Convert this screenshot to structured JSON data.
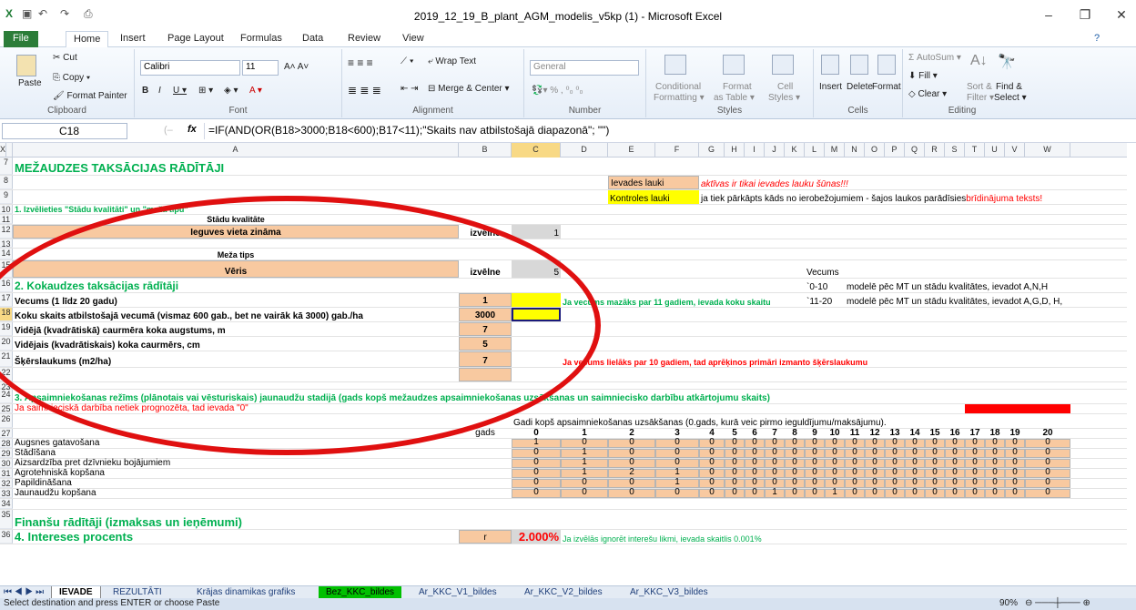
{
  "window": {
    "title": "2019_12_19_B_plant_AGM_modelis_v5kp (1)  -  Microsoft Excel",
    "min": "–",
    "max": "❐",
    "close": "✕"
  },
  "tabs": [
    "File",
    "Home",
    "Insert",
    "Page Layout",
    "Formulas",
    "Data",
    "Review",
    "View"
  ],
  "ribbon": {
    "clipboard": {
      "paste": "Paste",
      "cut": "Cut",
      "copy": "Copy ▾",
      "painter": "Format Painter",
      "label": "Clipboard"
    },
    "font": {
      "name": "Calibri",
      "size": "11",
      "label": "Font"
    },
    "alignment": {
      "wrap": "Wrap Text",
      "merge": "Merge & Center ▾",
      "label": "Alignment"
    },
    "number": {
      "format": "General",
      "label": "Number"
    },
    "styles": {
      "cond": "Conditional",
      "cond2": "Formatting ▾",
      "fmt": "Format",
      "fmt2": "as Table ▾",
      "cell": "Cell",
      "cell2": "Styles ▾",
      "label": "Styles"
    },
    "cells": {
      "insert": "Insert",
      "delete": "Delete",
      "format": "Format",
      "label": "Cells"
    },
    "editing": {
      "autosum": "Σ AutoSum ▾",
      "fill": "Fill ▾",
      "clear": "Clear ▾",
      "sort": "Sort &",
      "sort2": "Filter ▾",
      "find": "Find &",
      "find2": "Select ▾",
      "label": "Editing"
    }
  },
  "namebox": "C18",
  "fx": "fx",
  "formula": "=IF(AND(OR(B18>3000;B18<600);B17<11);\"Skaits nav atbilstošajā diapazonā\"; \"\")",
  "columns": [
    "A",
    "B",
    "C",
    "D",
    "E",
    "F",
    "G",
    "H",
    "I",
    "J",
    "K",
    "L",
    "M",
    "N",
    "O",
    "P",
    "Q",
    "R",
    "S",
    "T",
    "U",
    "V",
    "W",
    "X"
  ],
  "rows": {
    "r7": "MEŽAUDZES TAKSĀCIJAS RĀDĪTĀJI",
    "r8_e": "Ievades lauki",
    "r8_g": "aktīvas ir tikai ievades lauku šūnas!!!",
    "r9_e": "Kontroles lauki",
    "r9_g": "ja tiek pārkāpts kāds no ierobežojumiem - šajos laukos parādīsies ",
    "r9_g2": "brīdinājuma teksts!",
    "r10": "1. Izvēlieties \"Stādu kvalitāti\" un \"meža tipu\"",
    "r11": "Stādu kvalitāte",
    "r12": "Ieguves vieta zināma",
    "r12_b": "izvēlne",
    "r12_c": "1",
    "r14": "Meža tips",
    "r15": "Vēris",
    "r15_b": "izvēlne",
    "r15_c": "5",
    "r15_l": "Vecums",
    "r16": "2.  Kokaudzes taksācijas rādītāji",
    "r16_l": "`0-10",
    "r16_m": "modelē pēc MT un stādu kvalitātes, ievadot A,N,H",
    "r17": "Vecums (1 līdz 20 gadu)",
    "r17_b": "1",
    "r17_e": "Ja vecums mazāks par 11 gadiem, ievada koku skaitu",
    "r17_l": "`11-20",
    "r17_m": "modelē pēc MT un stādu kvalitātes, ievadot A,G,D, H,",
    "r18": "Koku skaits atbilstošajā vecumā (vismaz 600 gab., bet ne vairāk kā 3000) gab./ha",
    "r18_b": "3000",
    "r19": "Vidējā (kvadrātiskā) caurmēra koka augstums, m",
    "r19_b": "7",
    "r20": "Vidējais (kvadrātiskais) koka caurmērs, cm",
    "r20_b": "5",
    "r21": "Šķērslaukums (m2/ha)",
    "r21_b": "7",
    "r21_e": "Ja vecums lielāks par 10 gadiem, tad aprēķinos primāri izmanto šķērslaukumu",
    "r24": "3. Apsaimniekošanas režīms (plānotais vai vēsturiskais) jaunaudžu stadijā (gads kopš mežaudzes apsaimniekošanas uzsākšanas un saimniecisko darbību atkārtojumu skaits)",
    "r25": "Ja saimnieciskā darbība netiek prognozēta, tad ievada \"0\"",
    "r26": "Gadi kopš apsaimniekošanas uzsākšanas (0.gads, kurā veic pirmo ieguldījumu/maksājumu).",
    "r27_b": "gads",
    "years": [
      "0",
      "1",
      "2",
      "3",
      "4",
      "5",
      "6",
      "7",
      "8",
      "9",
      "10",
      "11",
      "12",
      "13",
      "14",
      "15",
      "16",
      "17",
      "18",
      "19",
      "20"
    ],
    "ops": [
      {
        "name": "Augsnes gatavošana",
        "v": [
          "1",
          "0",
          "0",
          "0",
          "0",
          "0",
          "0",
          "0",
          "0",
          "0",
          "0",
          "0",
          "0",
          "0",
          "0",
          "0",
          "0",
          "0",
          "0",
          "0",
          "0"
        ]
      },
      {
        "name": "Stādīšana",
        "v": [
          "0",
          "1",
          "0",
          "0",
          "0",
          "0",
          "0",
          "0",
          "0",
          "0",
          "0",
          "0",
          "0",
          "0",
          "0",
          "0",
          "0",
          "0",
          "0",
          "0",
          "0"
        ]
      },
      {
        "name": "Aizsardzība pret dzīvnieku bojājumiem",
        "v": [
          "0",
          "1",
          "0",
          "0",
          "0",
          "0",
          "0",
          "0",
          "0",
          "0",
          "0",
          "0",
          "0",
          "0",
          "0",
          "0",
          "0",
          "0",
          "0",
          "0",
          "0"
        ]
      },
      {
        "name": "Agrotehniskā kopšana",
        "v": [
          "0",
          "1",
          "2",
          "1",
          "0",
          "0",
          "0",
          "0",
          "0",
          "0",
          "0",
          "0",
          "0",
          "0",
          "0",
          "0",
          "0",
          "0",
          "0",
          "0",
          "0"
        ]
      },
      {
        "name": "Papildināšana",
        "v": [
          "0",
          "0",
          "0",
          "1",
          "0",
          "0",
          "0",
          "0",
          "0",
          "0",
          "0",
          "0",
          "0",
          "0",
          "0",
          "0",
          "0",
          "0",
          "0",
          "0",
          "0"
        ]
      },
      {
        "name": "Jaunaudžu kopšana",
        "v": [
          "0",
          "0",
          "0",
          "0",
          "0",
          "0",
          "0",
          "1",
          "0",
          "0",
          "1",
          "0",
          "0",
          "0",
          "0",
          "0",
          "0",
          "0",
          "0",
          "0",
          "0"
        ]
      }
    ],
    "r35": "Finanšu rādītāji (izmaksas un ieņēmumi)",
    "r36": "4. Intereses procents",
    "r36_b": "r",
    "r36_c": "2.000%",
    "r36_d": "Ja izvēlās ignorēt interešu likmi, ievada skaitlis 0.001%"
  },
  "sheets": [
    "IEVADE",
    "REZULTĀTI",
    "Krājas dinamikas grafiks",
    "Bez_KKC_bildes",
    "Ar_KKC_V1_bildes",
    "Ar_KKC_V2_bildes",
    "Ar_KKC_V3_bildes"
  ],
  "status": {
    "text": "Select destination and press ENTER or choose Paste",
    "zoom": "90%"
  }
}
